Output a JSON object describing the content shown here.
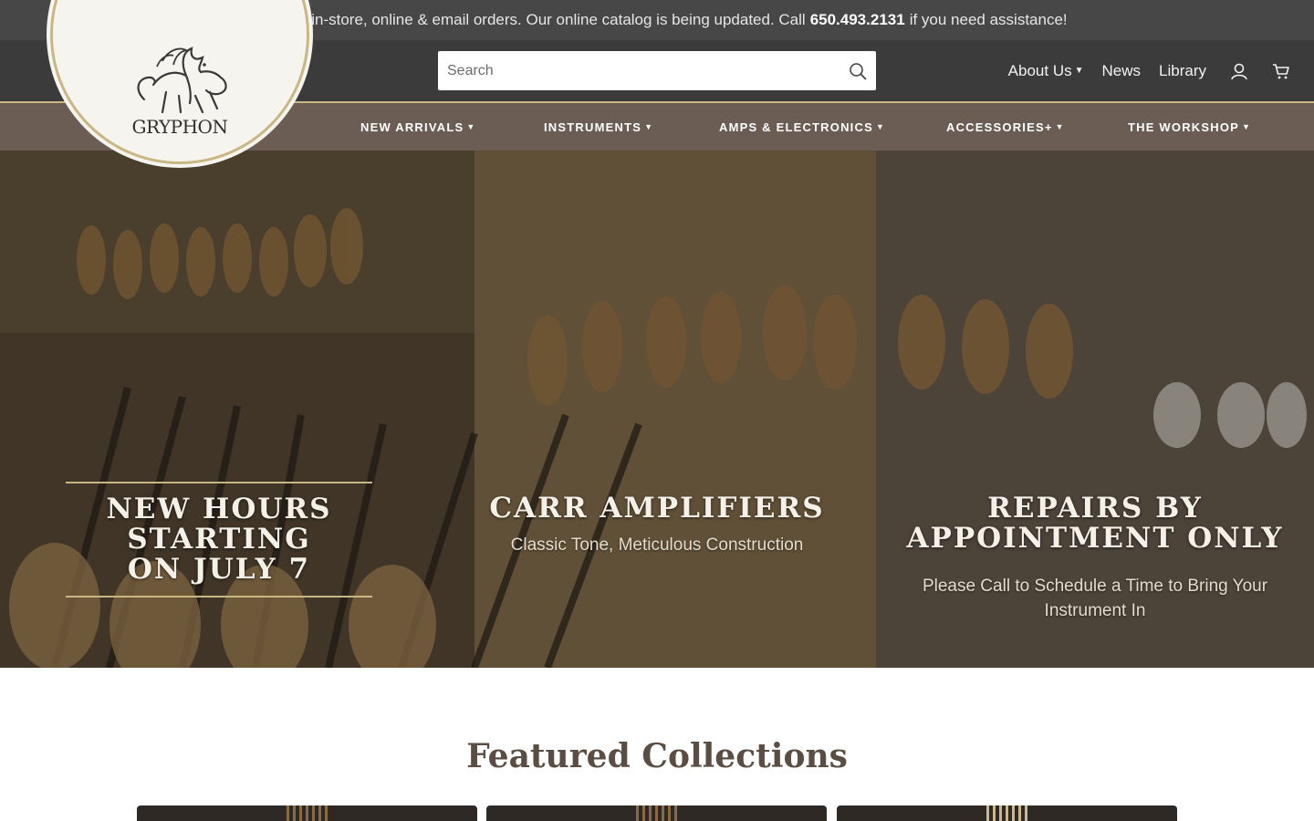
{
  "announcement": {
    "before": "Open for in-store, online & email orders. Our online catalog is being updated. Call",
    "phone": "650.493.2131",
    "after": "if you need assistance!"
  },
  "logo": {
    "text": "GRYPHON"
  },
  "search": {
    "placeholder": "Search",
    "icon": "search-icon"
  },
  "utility_nav": {
    "about": "About Us",
    "news": "News",
    "library": "Library",
    "account_icon": "user-icon",
    "cart_icon": "cart-icon"
  },
  "main_nav": [
    {
      "label": "NEW ARRIVALS"
    },
    {
      "label": "INSTRUMENTS"
    },
    {
      "label": "AMPS & ELECTRONICS"
    },
    {
      "label": "ACCESSORIES+"
    },
    {
      "label": "THE WORKSHOP"
    }
  ],
  "hero": {
    "slides": [
      {
        "title_line1": "NEW HOURS STARTING",
        "title_line2": "ON JULY 7",
        "subtitle": ""
      },
      {
        "title_line1": "CARR AMPLIFIERS",
        "title_line2": "",
        "subtitle": "Classic Tone, Meticulous Construction"
      },
      {
        "title_line1": "REPAIRS BY",
        "title_line2": "APPOINTMENT ONLY",
        "subtitle_line1": "Please Call to Schedule a Time to Bring Your",
        "subtitle_line2": "Instrument In"
      }
    ]
  },
  "featured": {
    "heading": "Featured Collections"
  },
  "colors": {
    "announcement_bg": "#474747",
    "header_bg": "#3b3b3b",
    "nav_bg": "#6b5d53",
    "gold_accent": "#c9b783",
    "heading_brown": "#594d44"
  }
}
